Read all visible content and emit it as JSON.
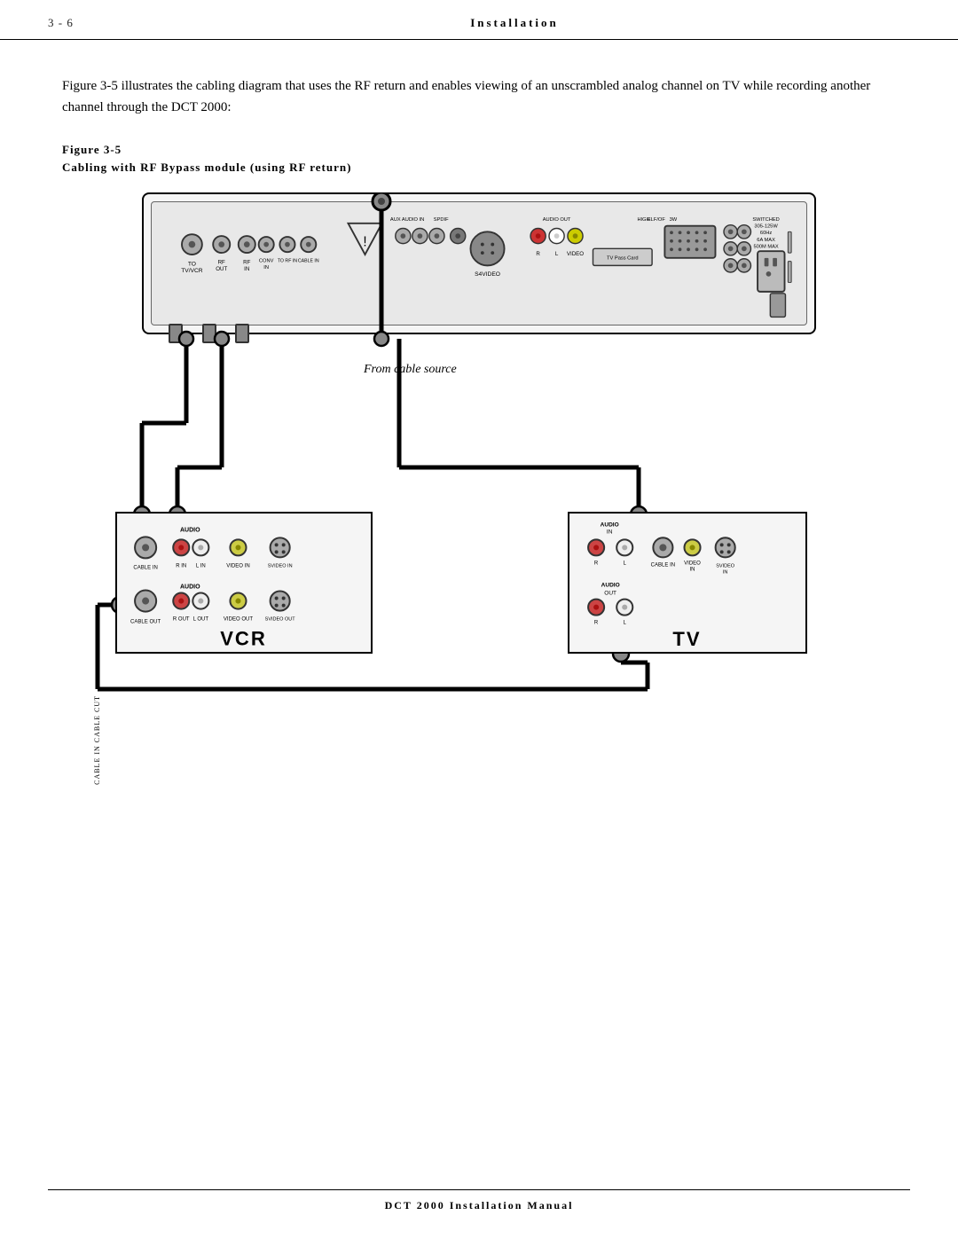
{
  "header": {
    "page_number": "3 - 6",
    "title": "Installation"
  },
  "footer": {
    "text": "DCT 2000 Installation Manual"
  },
  "content": {
    "intro": "Figure 3-5 illustrates the cabling diagram that uses the RF return and enables viewing of an unscrambled analog channel on TV while recording another channel through the DCT 2000:",
    "figure_label": "Figure 3-5",
    "figure_caption": "Cabling with RF Bypass module (using RF return)",
    "cable_source_label": "From cable source",
    "vcr_label": "VCR",
    "tv_label": "TV"
  },
  "dct_ports_left": [
    {
      "label": "TO\nTV/VCR"
    },
    {
      "label": "RF\nOUT"
    },
    {
      "label": "RF\nIN"
    },
    {
      "label": "CONV\nIN"
    },
    {
      "label": "TO RF IN"
    },
    {
      "label": "CABLE IN"
    }
  ],
  "vcr_ports_top_row1": [
    {
      "label": "CABLE IN"
    },
    {
      "label": "AUDIO\nR IN"
    },
    {
      "label": "L IN"
    },
    {
      "label": "VIDEO IN"
    },
    {
      "label": "SVIDEO IN"
    }
  ],
  "vcr_ports_top_row2": [
    {
      "label": "CABLE OUT"
    },
    {
      "label": "AUDIO\nR OUT"
    },
    {
      "label": "L OUT"
    },
    {
      "label": "VIDEO OUT"
    },
    {
      "label": "SVIDEO OUT"
    }
  ],
  "tv_ports": [
    {
      "label": "AUDIO\nR IN"
    },
    {
      "label": "L"
    },
    {
      "label": "CABLE IN"
    },
    {
      "label": "AUDIO\nOUT\nR L"
    },
    {
      "label": "VIDEO\nIN"
    },
    {
      "label": "SVIDEO\nIN"
    }
  ]
}
